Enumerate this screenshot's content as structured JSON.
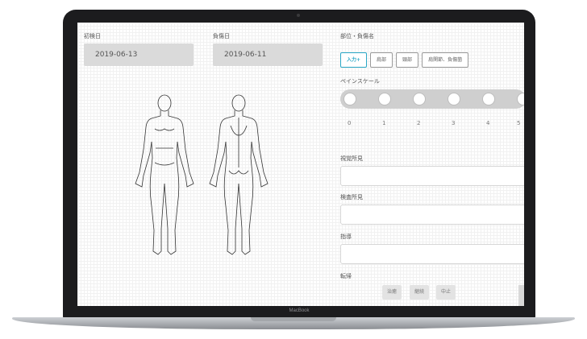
{
  "device": {
    "brand": "MacBook"
  },
  "form": {
    "first_visit_label": "初検日",
    "first_visit_value": "2019-06-13",
    "injury_date_label": "負傷日",
    "injury_date_value": "2019-06-11",
    "region_label": "部位・負傷名",
    "region_tabs": [
      {
        "label": "入力+",
        "active": true
      },
      {
        "label": "肩部",
        "active": false
      },
      {
        "label": "頸部",
        "active": false
      },
      {
        "label": "肩関節、負傷箇",
        "active": false
      }
    ],
    "pain_scale_label": "ペインスケール",
    "pain_scale_values": [
      "0",
      "1",
      "2",
      "3",
      "4",
      "5"
    ],
    "finding1_label": "視覚所見",
    "finding2_label": "検査所見",
    "guidance_label": "指導",
    "outcome_label": "転帰",
    "outcome_buttons": [
      "治癒",
      "継続",
      "中止"
    ]
  },
  "colors": {
    "accent": "#29a7c6",
    "date_box": "#dadada",
    "laptop": "#1c1c1e"
  },
  "icons": {
    "front_body": "human-body-front-icon",
    "back_body": "human-body-back-icon"
  }
}
